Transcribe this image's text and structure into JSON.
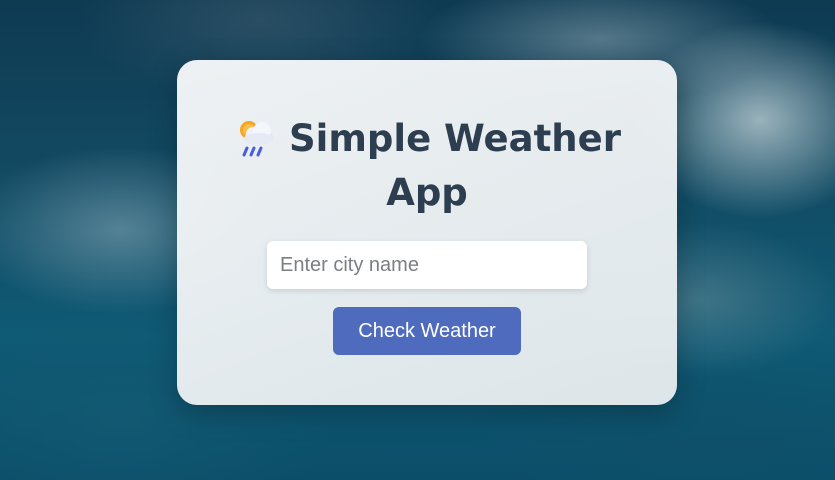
{
  "app": {
    "title": "Simple Weather App",
    "title_icon": "sun-behind-rain-cloud-icon"
  },
  "search": {
    "placeholder": "Enter city name",
    "value": ""
  },
  "actions": {
    "check_label": "Check Weather"
  },
  "colors": {
    "title_text": "#2d3e50",
    "button_bg": "#4e6bbd",
    "button_text": "#ffffff",
    "card_bg": "#eef1f3"
  }
}
